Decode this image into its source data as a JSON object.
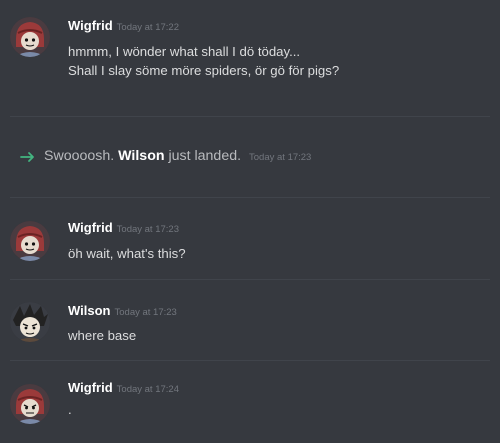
{
  "messages": [
    {
      "username": "Wigfrid",
      "timestamp": "Today at 17:22",
      "lines": [
        "hmmm, I wönder what shall I dö töday...",
        "Shall I slay söme möre spiders, ör gö för pigs?"
      ],
      "avatar": "wigfrid-avatar-icon"
    },
    {
      "username": "Wigfrid",
      "timestamp": "Today at 17:23",
      "lines": [
        "öh wait, what's this?"
      ],
      "avatar": "wigfrid-avatar-icon"
    },
    {
      "username": "Wilson",
      "timestamp": "Today at 17:23",
      "lines": [
        "where base"
      ],
      "avatar": "wilson-avatar-icon"
    },
    {
      "username": "Wigfrid",
      "timestamp": "Today at 17:24",
      "lines": [
        "."
      ],
      "avatar": "wigfrid-avatar-icon"
    }
  ],
  "system_message": {
    "icon": "arrow-right-icon",
    "prefix": "Swoooosh.",
    "user": "Wilson",
    "suffix": "just landed.",
    "timestamp": "Today at 17:23"
  },
  "colors": {
    "background": "#36393f",
    "username": "#ffffff",
    "timestamp": "#72767d",
    "text": "#dcddde",
    "system_arrow": "#43b581",
    "divider": "#40444b"
  }
}
